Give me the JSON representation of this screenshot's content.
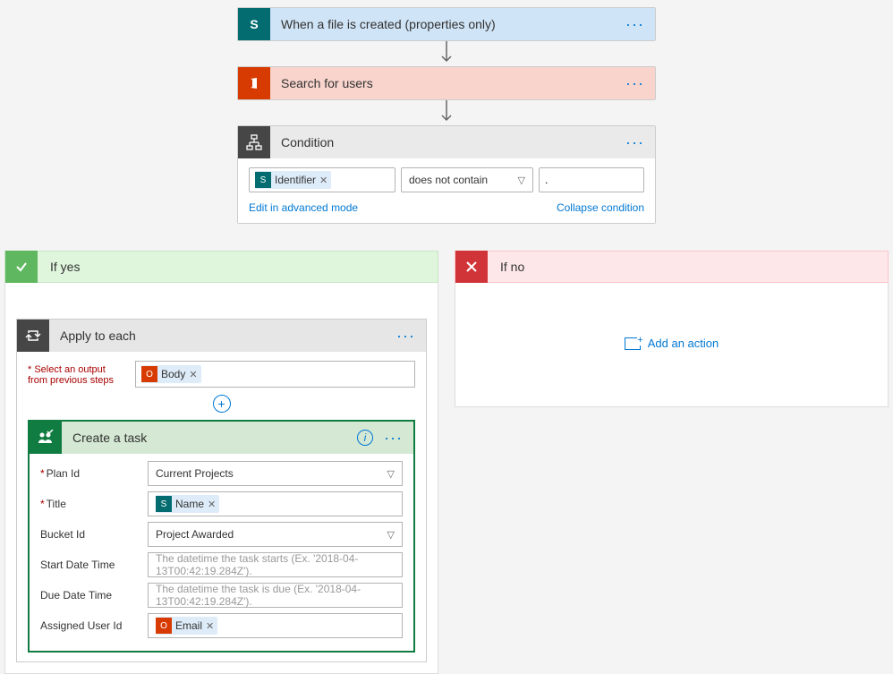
{
  "trigger": {
    "title": "When a file is created (properties only)"
  },
  "search_users": {
    "title": "Search for users"
  },
  "condition": {
    "title": "Condition",
    "identifier_token": "Identifier",
    "operator": "does not contain",
    "value": ".",
    "edit_link": "Edit in advanced mode",
    "collapse_link": "Collapse condition"
  },
  "branches": {
    "yes_label": "If yes",
    "no_label": "If no",
    "add_action": "Add an action"
  },
  "apply": {
    "title": "Apply to each",
    "select_label": "* Select an output from previous steps",
    "body_token": "Body"
  },
  "task": {
    "title": "Create a task",
    "fields": {
      "plan_id": {
        "label": "Plan Id",
        "value": "Current Projects",
        "required": true
      },
      "title": {
        "label": "Title",
        "token": "Name",
        "required": true
      },
      "bucket_id": {
        "label": "Bucket Id",
        "value": "Project Awarded",
        "required": false
      },
      "start_dt": {
        "label": "Start Date Time",
        "placeholder": "The datetime the task starts (Ex. '2018-04-13T00:42:19.284Z')."
      },
      "due_dt": {
        "label": "Due Date Time",
        "placeholder": "The datetime the task is due (Ex. '2018-04-13T00:42:19.284Z')."
      },
      "assigned": {
        "label": "Assigned User Id",
        "token": "Email"
      }
    }
  }
}
